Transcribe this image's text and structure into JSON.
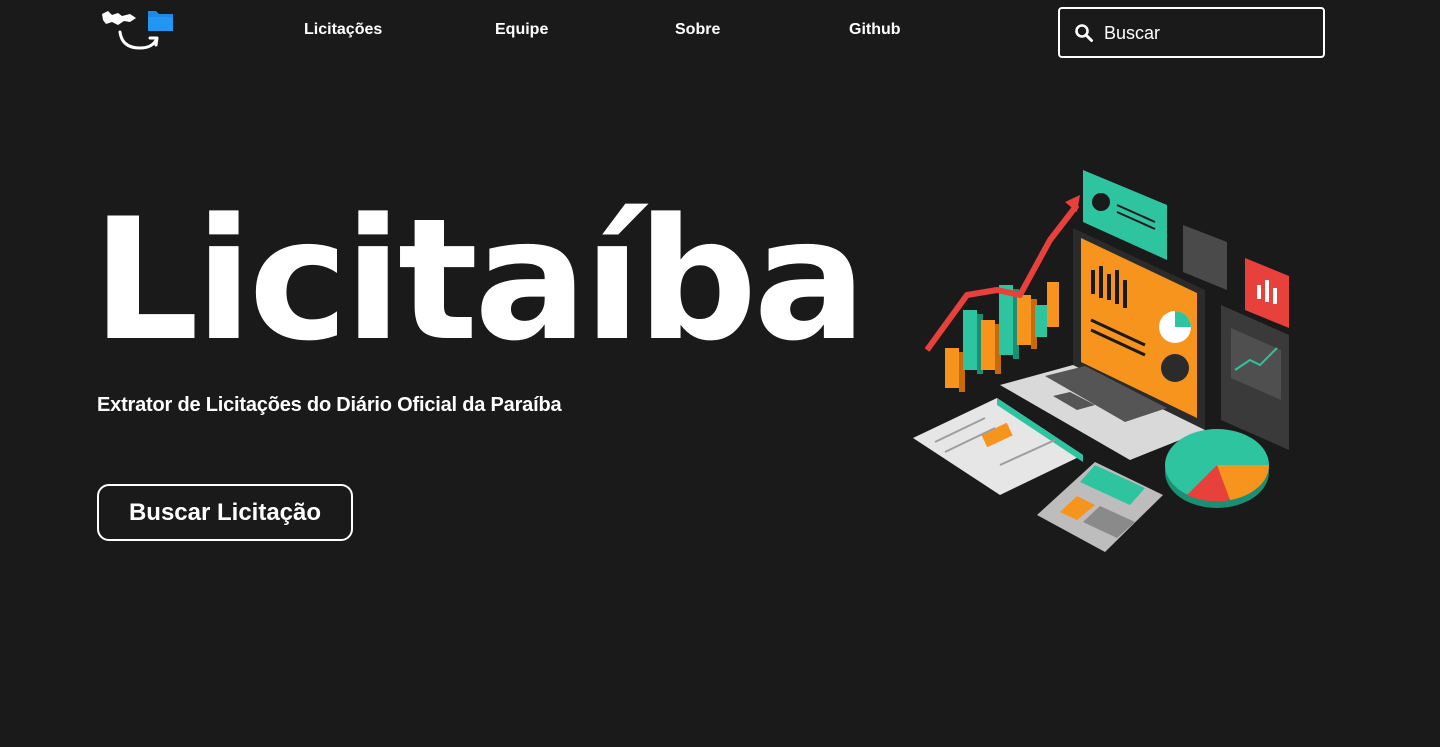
{
  "header": {
    "logo_name": "licitaiba-logo",
    "nav": [
      {
        "label": "Licitações"
      },
      {
        "label": "Equipe"
      },
      {
        "label": "Sobre"
      },
      {
        "label": "Github"
      }
    ],
    "search": {
      "placeholder": "Buscar",
      "icon": "search-icon"
    }
  },
  "hero": {
    "title": "Licitaíba",
    "subtitle": "Extrator de Licitações do Diário Oficial da Paraíba",
    "cta_label": "Buscar Licitação",
    "illustration": "isometric-data-analytics-illustration"
  },
  "colors": {
    "background": "#1a1a1b",
    "text": "#ffffff",
    "accent_orange": "#f7941d",
    "accent_teal": "#2ec4a0",
    "accent_red": "#e8413c",
    "accent_blue": "#1e88e5"
  }
}
